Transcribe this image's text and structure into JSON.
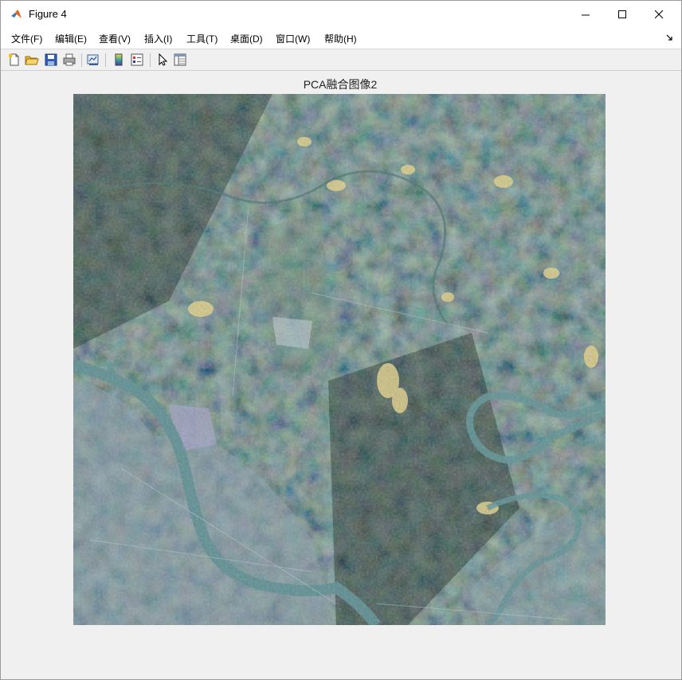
{
  "window": {
    "title": "Figure 4",
    "controls": {
      "minimize": "minimize",
      "maximize": "maximize",
      "close": "close"
    }
  },
  "menu": {
    "items": [
      "文件(F)",
      "编辑(E)",
      "查看(V)",
      "插入(I)",
      "工具(T)",
      "桌面(D)",
      "窗口(W)",
      "帮助(H)"
    ]
  },
  "toolbar": {
    "buttons": [
      "new-figure-icon",
      "open-file-icon",
      "save-icon",
      "print-icon",
      "link-plot-icon",
      "insert-colorbar-icon",
      "insert-legend-icon",
      "edit-plot-pointer-icon",
      "property-inspector-icon"
    ]
  },
  "axes": {
    "title": "PCA融合图像2"
  },
  "colors": {
    "window_bg": "#f0f0f0",
    "titlebar_bg": "#ffffff",
    "river": "#5a8f94",
    "urban": "#8a9cb0",
    "vegetation_dark": "#1f2b24",
    "vegetation": "#4d6b4a",
    "bare_soil": "#e3cf86"
  }
}
